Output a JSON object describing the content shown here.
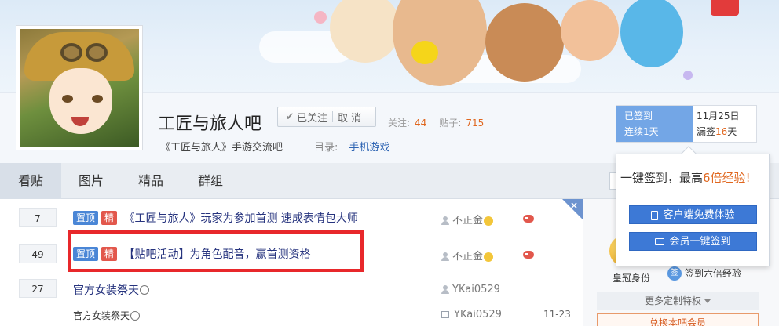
{
  "colors": {
    "accent": "#3d79d6",
    "highlight_red": "#e8282b",
    "orange": "#e0671f"
  },
  "forum": {
    "name": "工匠与旅人吧",
    "follow_state": "已关注",
    "unfollow_label": "取 消",
    "follow_count_label": "关注:",
    "follow_count": "44",
    "post_count_label": "贴子:",
    "post_count": "715",
    "slogan": "《工匠与旅人》手游交流吧",
    "catalog_label": "目录:",
    "catalog_value": "手机游戏"
  },
  "signin": {
    "status": "已签到",
    "streak": "连续1天",
    "date": "11月25日",
    "missed_prefix": "漏签",
    "missed_days": "16",
    "missed_suffix": "天"
  },
  "tabs": [
    "看贴",
    "图片",
    "精品",
    "群组"
  ],
  "threads": [
    {
      "replies": "7",
      "top": "置顶",
      "good": "精",
      "title": "《工匠与旅人》玩家为参加首测 速成表情包大师",
      "author": "不正金",
      "date": ""
    },
    {
      "replies": "49",
      "top": "置顶",
      "good": "精",
      "title": "【贴吧活动】为角色配音，赢首测资格",
      "author": "不正金",
      "date": ""
    },
    {
      "replies": "27",
      "top": "",
      "good": "",
      "title": "官方女装祭天",
      "author": "YKai0529",
      "date": ""
    },
    {
      "replies": "",
      "top": "",
      "good": "",
      "title": "官方女装祭天",
      "author": "YKai0529",
      "date": "11-23"
    }
  ],
  "close_label": "×",
  "popup": {
    "title_prefix": "一键签到，最高",
    "title_highlight": "6倍经验",
    "title_suffix": "!",
    "client_button": "客户端免费体验",
    "member_button": "会员一键签到"
  },
  "sidebar": {
    "crown_label": "皇冠身份",
    "sign6_label": "签到六倍经验",
    "more_privileges": "更多定制特权",
    "member_button": "兑换本吧会员"
  },
  "icons": [
    "check-icon",
    "user-icon",
    "emoji-icon",
    "game-icon",
    "phone-icon",
    "monitor-icon",
    "crown-icon",
    "sign-icon",
    "close-icon",
    "chevron-down-icon"
  ]
}
